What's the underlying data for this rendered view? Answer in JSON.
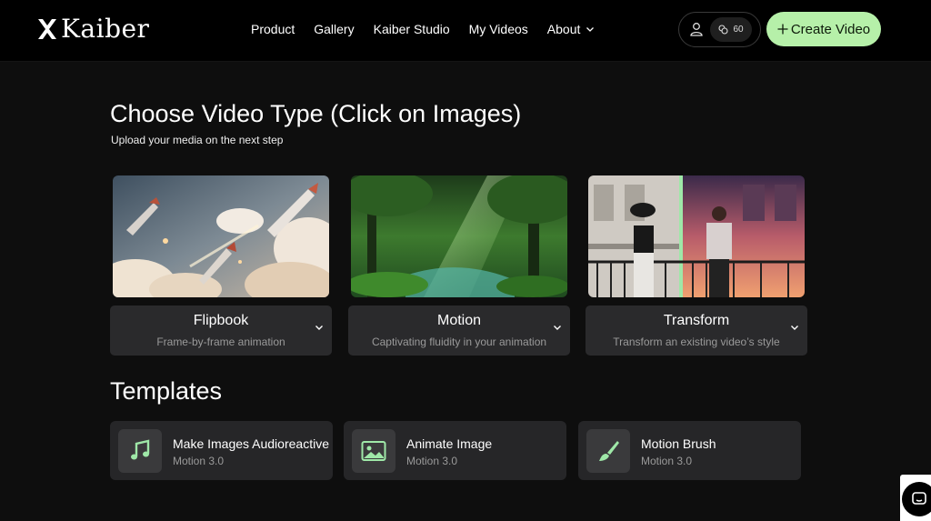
{
  "brand": {
    "name": "Kaiber"
  },
  "nav": {
    "items": [
      {
        "label": "Product"
      },
      {
        "label": "Gallery"
      },
      {
        "label": "Kaiber Studio"
      },
      {
        "label": "My Videos"
      },
      {
        "label": "About"
      }
    ]
  },
  "account": {
    "credits": "60",
    "user_icon": "user-icon",
    "credits_icon": "coins-icon"
  },
  "create_button": {
    "label": "Create Video",
    "icon": "plus-icon"
  },
  "page": {
    "title": "Choose Video Type (Click on Images)",
    "subtitle": "Upload your media on the next step"
  },
  "video_types": [
    {
      "name": "Flipbook",
      "description": "Frame-by-frame animation"
    },
    {
      "name": "Motion",
      "description": "Captivating fluidity in your animation"
    },
    {
      "name": "Transform",
      "description": "Transform an existing video’s style"
    }
  ],
  "templates": {
    "title": "Templates",
    "items": [
      {
        "name": "Make Images Audioreactive",
        "version": "Motion 3.0",
        "icon": "music-note-icon"
      },
      {
        "name": "Animate Image",
        "version": "Motion 3.0",
        "icon": "image-icon"
      },
      {
        "name": "Motion Brush",
        "version": "Motion 3.0",
        "icon": "brush-icon"
      }
    ]
  },
  "colors": {
    "accent": "#b6f0a9",
    "background": "#0e0e0e",
    "card": "#2a2a2c"
  }
}
